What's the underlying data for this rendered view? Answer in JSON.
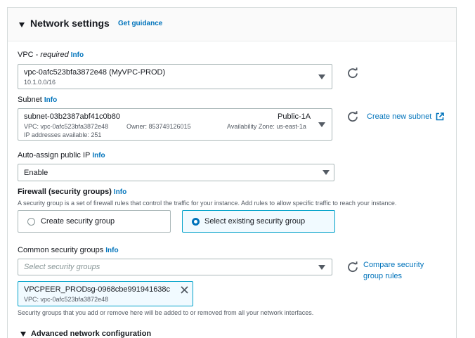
{
  "section": {
    "title": "Network settings",
    "guidance_link": "Get guidance"
  },
  "vpc": {
    "label": "VPC - ",
    "required": "required",
    "info": "Info",
    "value": "vpc-0afc523bfa3872e48 (MyVPC-PROD)",
    "cidr": "10.1.0.0/16"
  },
  "subnet": {
    "label": "Subnet",
    "info": "Info",
    "value": "subnet-03b2387abf41c0b80",
    "name": "Public-1A",
    "vpc_detail": "VPC: vpc-0afc523bfa3872e48",
    "owner_detail": "Owner: 853749126015",
    "az_detail": "Availability Zone: us-east-1a",
    "ips_detail": "IP addresses available: 251",
    "create_link": "Create new subnet"
  },
  "public_ip": {
    "label": "Auto-assign public IP",
    "info": "Info",
    "value": "Enable"
  },
  "firewall": {
    "label": "Firewall (security groups)",
    "info": "Info",
    "description": "A security group is a set of firewall rules that control the traffic for your instance. Add rules to allow specific traffic to reach your instance.",
    "option_create": "Create security group",
    "option_select": "Select existing security group",
    "selected": "select"
  },
  "common_sg": {
    "label": "Common security groups",
    "info": "Info",
    "placeholder": "Select security groups",
    "compare_link_line1": "Compare security",
    "compare_link_line2": "group rules",
    "token_name": "VPCPEER_PROD",
    "token_id": "sg-0968cbe991941638c",
    "token_vpc": "VPC: vpc-0afc523bfa3872e48",
    "note": "Security groups that you add or remove here will be added to or removed from all your network interfaces."
  },
  "advanced": {
    "label": "Advanced network configuration"
  },
  "icons": {
    "refresh": "refresh-icon",
    "external": "external-link-icon",
    "close": "close-icon",
    "caret": "caret-down-icon"
  },
  "colors": {
    "link": "#0073bb",
    "selected_border": "#00a1c9",
    "selected_bg": "#f1faff"
  }
}
